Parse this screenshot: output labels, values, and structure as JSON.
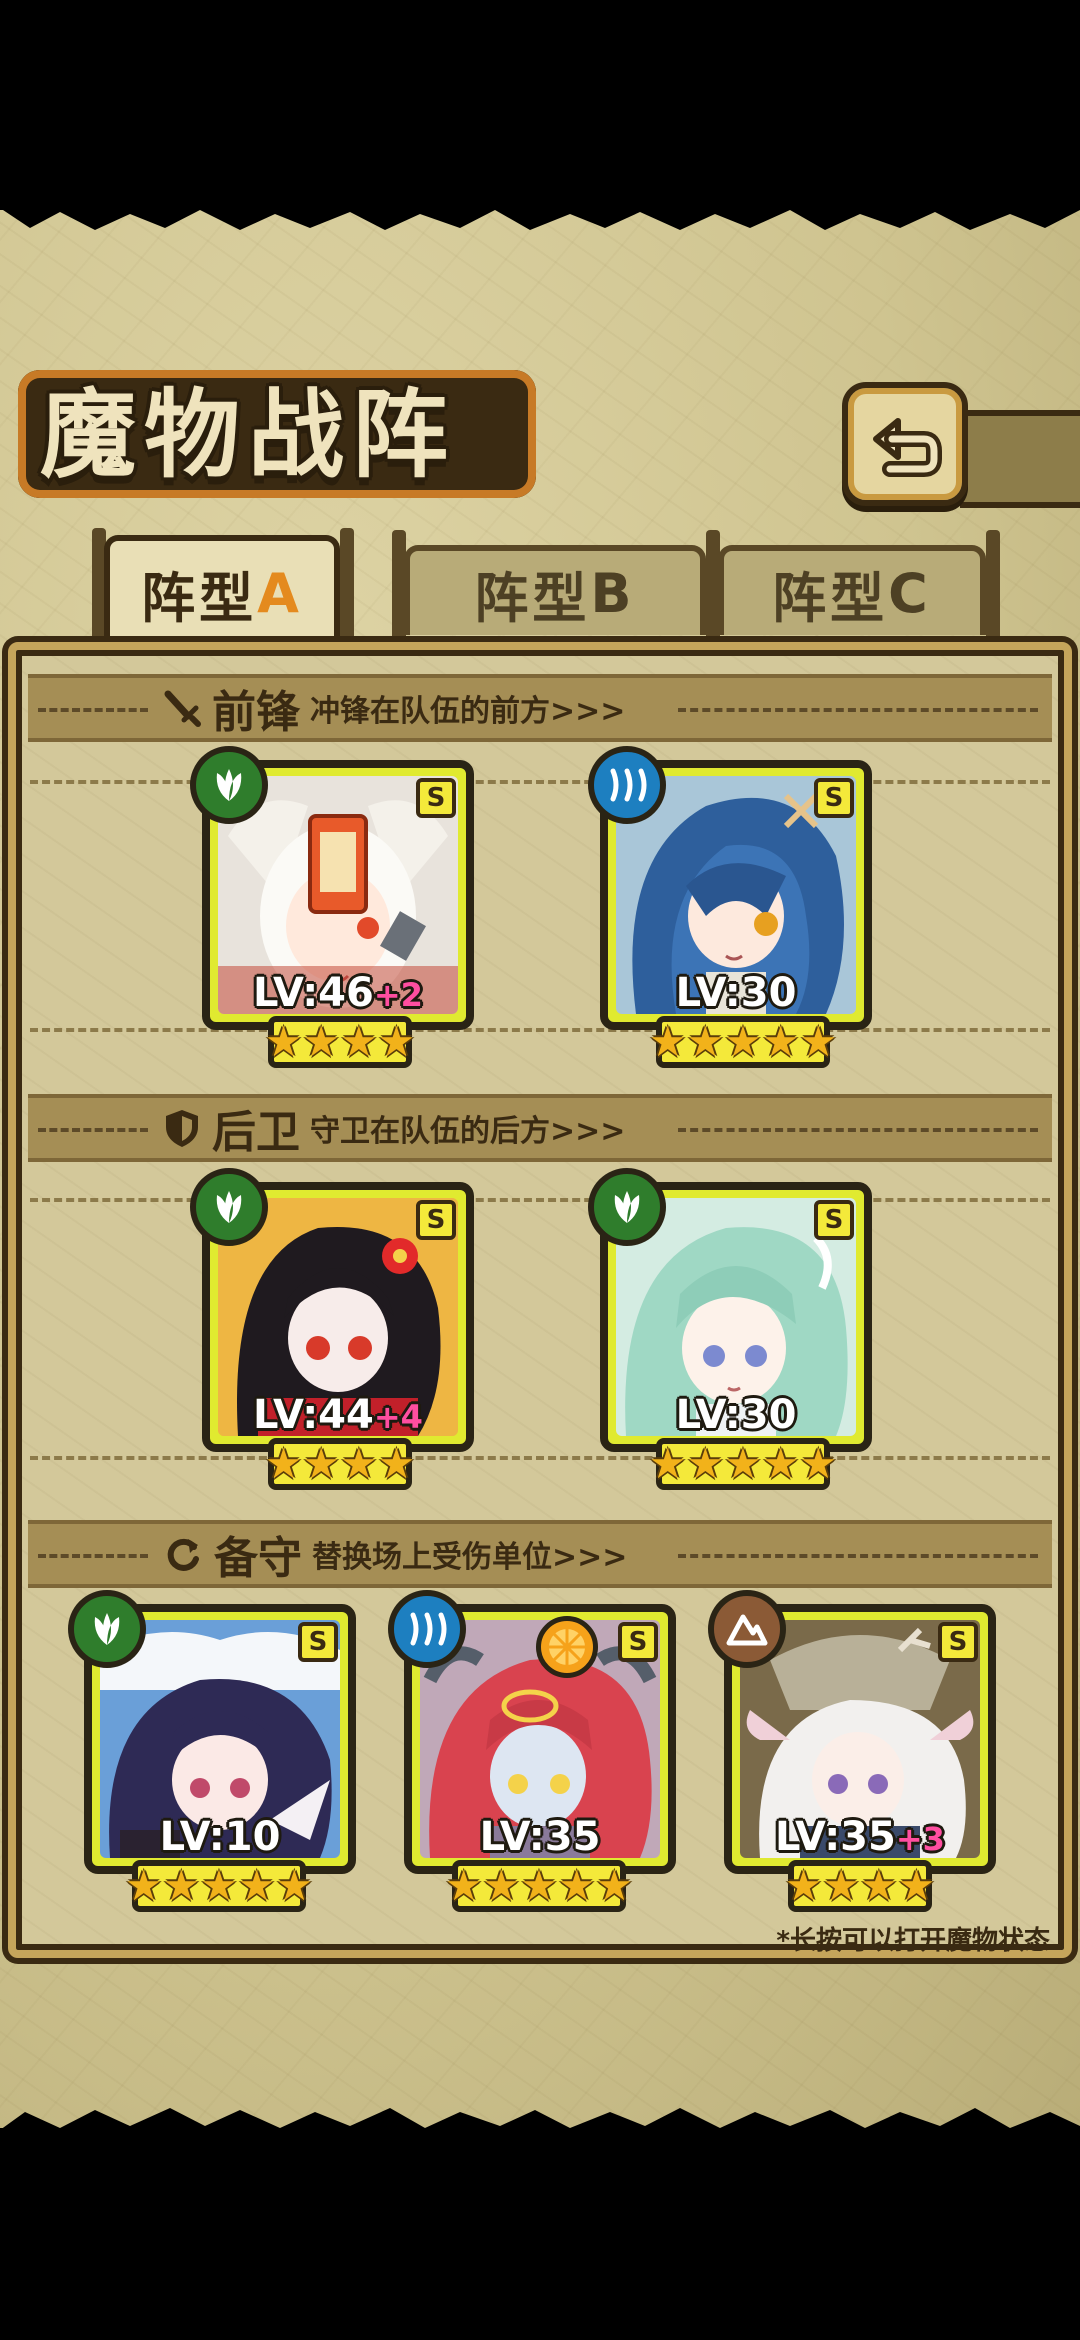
{
  "screen": {
    "title": "魔物战阵",
    "back_icon": "return-arrow-icon"
  },
  "tabs": [
    {
      "prefix": "阵型",
      "letter": "A",
      "active": true
    },
    {
      "prefix": "阵型",
      "letter": "B",
      "active": false
    },
    {
      "prefix": "阵型",
      "letter": "C",
      "active": false
    }
  ],
  "sections": {
    "front": {
      "icon": "sword-icon",
      "title": "前锋",
      "subtitle": "冲锋在队伍的前方>>>"
    },
    "back": {
      "icon": "shield-icon",
      "title": "后卫",
      "subtitle": "守卫在队伍的后方>>>"
    },
    "reserve": {
      "icon": "swap-icon",
      "title": "备守",
      "subtitle": "替换场上受伤单位>>>"
    }
  },
  "monsters": [
    {
      "rank": "S",
      "element": "nature",
      "level": "LV:46",
      "bonus": "+2",
      "stars": 4
    },
    {
      "rank": "S",
      "element": "water",
      "level": "LV:30",
      "bonus": "",
      "stars": 5
    },
    {
      "rank": "S",
      "element": "nature",
      "level": "LV:44",
      "bonus": "+4",
      "stars": 4
    },
    {
      "rank": "S",
      "element": "nature",
      "level": "LV:30",
      "bonus": "",
      "stars": 5
    },
    {
      "rank": "S",
      "element": "nature",
      "level": "LV:10",
      "bonus": "",
      "stars": 5
    },
    {
      "rank": "S",
      "element": "water",
      "level": "LV:35",
      "bonus": "",
      "stars": 5
    },
    {
      "rank": "S",
      "element": "earth",
      "level": "LV:35",
      "bonus": "+3",
      "stars": 4
    }
  ],
  "footer_hint": "*长按可以打开魔物状态",
  "colors": {
    "parchment": "#cfc490",
    "frame_dark": "#3a2a12",
    "card_border_yellow": "#e0ea30",
    "nature": "#2f7d2c",
    "water": "#1d7fc0",
    "earth": "#8b5a36",
    "bonus_pink": "#ff4ea0"
  }
}
